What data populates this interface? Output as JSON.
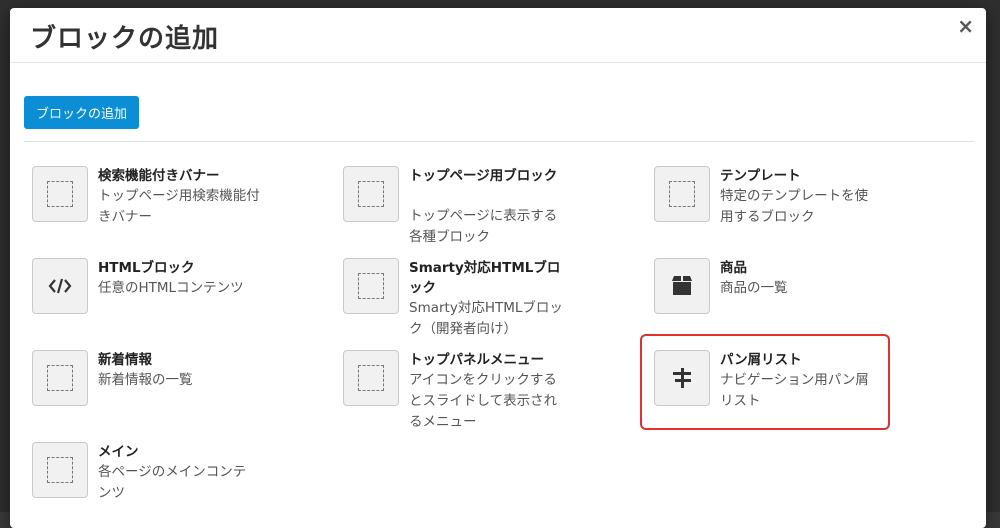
{
  "modal": {
    "title": "ブロックの追加",
    "close_label": "×",
    "add_button_label": "ブロックの追加"
  },
  "blocks": [
    {
      "name": "検索機能付きバナー",
      "desc": "トップページ用検索機能付きバナー",
      "icon": "dotted-square-icon"
    },
    {
      "name": "トップページ用ブロック",
      "desc": "トップページに表示する各種ブロック",
      "icon": "dotted-square-icon"
    },
    {
      "name": "テンプレート",
      "desc": "特定のテンプレートを使用するブロック",
      "icon": "dotted-square-icon"
    },
    {
      "name": "HTMLブロック",
      "desc": "任意のHTMLコンテンツ",
      "icon": "code-icon"
    },
    {
      "name": "Smarty対応HTMLブロック",
      "desc": "Smarty対応HTMLブロック（開発者向け）",
      "icon": "dotted-square-icon"
    },
    {
      "name": "商品",
      "desc": "商品の一覧",
      "icon": "box-icon"
    },
    {
      "name": "新着情報",
      "desc": "新着情報の一覧",
      "icon": "dotted-square-icon"
    },
    {
      "name": "トップパネルメニュー",
      "desc": "アイコンをクリックするとスライドして表示されるメニュー",
      "icon": "dotted-square-icon"
    },
    {
      "name": "パン屑リスト",
      "desc": "ナビゲーション用パン屑リスト",
      "icon": "signpost-icon"
    },
    {
      "name": "メイン",
      "desc": "各ページのメインコンテンツ",
      "icon": "dotted-square-icon"
    }
  ]
}
